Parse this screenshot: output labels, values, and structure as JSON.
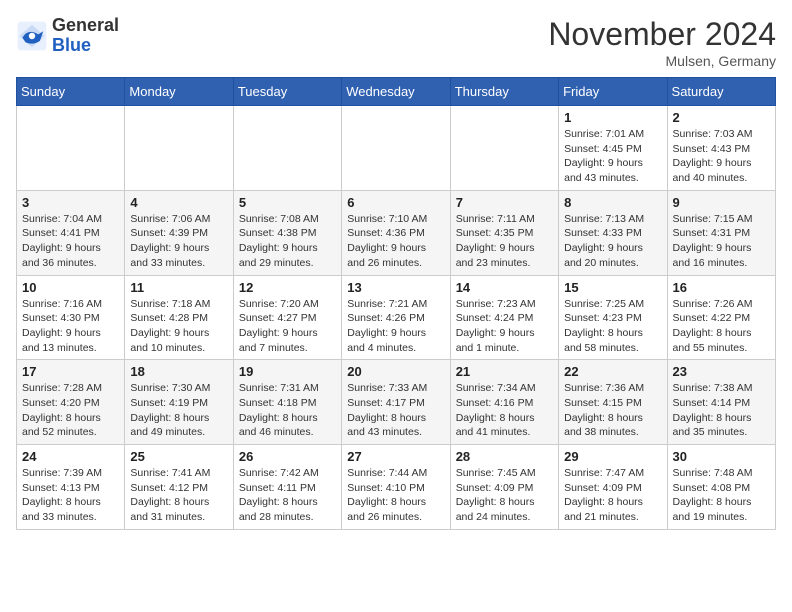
{
  "header": {
    "logo_general": "General",
    "logo_blue": "Blue",
    "month_title": "November 2024",
    "location": "Mulsen, Germany"
  },
  "columns": [
    "Sunday",
    "Monday",
    "Tuesday",
    "Wednesday",
    "Thursday",
    "Friday",
    "Saturday"
  ],
  "weeks": [
    [
      {
        "day": "",
        "info": ""
      },
      {
        "day": "",
        "info": ""
      },
      {
        "day": "",
        "info": ""
      },
      {
        "day": "",
        "info": ""
      },
      {
        "day": "",
        "info": ""
      },
      {
        "day": "1",
        "info": "Sunrise: 7:01 AM\nSunset: 4:45 PM\nDaylight: 9 hours\nand 43 minutes."
      },
      {
        "day": "2",
        "info": "Sunrise: 7:03 AM\nSunset: 4:43 PM\nDaylight: 9 hours\nand 40 minutes."
      }
    ],
    [
      {
        "day": "3",
        "info": "Sunrise: 7:04 AM\nSunset: 4:41 PM\nDaylight: 9 hours\nand 36 minutes."
      },
      {
        "day": "4",
        "info": "Sunrise: 7:06 AM\nSunset: 4:39 PM\nDaylight: 9 hours\nand 33 minutes."
      },
      {
        "day": "5",
        "info": "Sunrise: 7:08 AM\nSunset: 4:38 PM\nDaylight: 9 hours\nand 29 minutes."
      },
      {
        "day": "6",
        "info": "Sunrise: 7:10 AM\nSunset: 4:36 PM\nDaylight: 9 hours\nand 26 minutes."
      },
      {
        "day": "7",
        "info": "Sunrise: 7:11 AM\nSunset: 4:35 PM\nDaylight: 9 hours\nand 23 minutes."
      },
      {
        "day": "8",
        "info": "Sunrise: 7:13 AM\nSunset: 4:33 PM\nDaylight: 9 hours\nand 20 minutes."
      },
      {
        "day": "9",
        "info": "Sunrise: 7:15 AM\nSunset: 4:31 PM\nDaylight: 9 hours\nand 16 minutes."
      }
    ],
    [
      {
        "day": "10",
        "info": "Sunrise: 7:16 AM\nSunset: 4:30 PM\nDaylight: 9 hours\nand 13 minutes."
      },
      {
        "day": "11",
        "info": "Sunrise: 7:18 AM\nSunset: 4:28 PM\nDaylight: 9 hours\nand 10 minutes."
      },
      {
        "day": "12",
        "info": "Sunrise: 7:20 AM\nSunset: 4:27 PM\nDaylight: 9 hours\nand 7 minutes."
      },
      {
        "day": "13",
        "info": "Sunrise: 7:21 AM\nSunset: 4:26 PM\nDaylight: 9 hours\nand 4 minutes."
      },
      {
        "day": "14",
        "info": "Sunrise: 7:23 AM\nSunset: 4:24 PM\nDaylight: 9 hours\nand 1 minute."
      },
      {
        "day": "15",
        "info": "Sunrise: 7:25 AM\nSunset: 4:23 PM\nDaylight: 8 hours\nand 58 minutes."
      },
      {
        "day": "16",
        "info": "Sunrise: 7:26 AM\nSunset: 4:22 PM\nDaylight: 8 hours\nand 55 minutes."
      }
    ],
    [
      {
        "day": "17",
        "info": "Sunrise: 7:28 AM\nSunset: 4:20 PM\nDaylight: 8 hours\nand 52 minutes."
      },
      {
        "day": "18",
        "info": "Sunrise: 7:30 AM\nSunset: 4:19 PM\nDaylight: 8 hours\nand 49 minutes."
      },
      {
        "day": "19",
        "info": "Sunrise: 7:31 AM\nSunset: 4:18 PM\nDaylight: 8 hours\nand 46 minutes."
      },
      {
        "day": "20",
        "info": "Sunrise: 7:33 AM\nSunset: 4:17 PM\nDaylight: 8 hours\nand 43 minutes."
      },
      {
        "day": "21",
        "info": "Sunrise: 7:34 AM\nSunset: 4:16 PM\nDaylight: 8 hours\nand 41 minutes."
      },
      {
        "day": "22",
        "info": "Sunrise: 7:36 AM\nSunset: 4:15 PM\nDaylight: 8 hours\nand 38 minutes."
      },
      {
        "day": "23",
        "info": "Sunrise: 7:38 AM\nSunset: 4:14 PM\nDaylight: 8 hours\nand 35 minutes."
      }
    ],
    [
      {
        "day": "24",
        "info": "Sunrise: 7:39 AM\nSunset: 4:13 PM\nDaylight: 8 hours\nand 33 minutes."
      },
      {
        "day": "25",
        "info": "Sunrise: 7:41 AM\nSunset: 4:12 PM\nDaylight: 8 hours\nand 31 minutes."
      },
      {
        "day": "26",
        "info": "Sunrise: 7:42 AM\nSunset: 4:11 PM\nDaylight: 8 hours\nand 28 minutes."
      },
      {
        "day": "27",
        "info": "Sunrise: 7:44 AM\nSunset: 4:10 PM\nDaylight: 8 hours\nand 26 minutes."
      },
      {
        "day": "28",
        "info": "Sunrise: 7:45 AM\nSunset: 4:09 PM\nDaylight: 8 hours\nand 24 minutes."
      },
      {
        "day": "29",
        "info": "Sunrise: 7:47 AM\nSunset: 4:09 PM\nDaylight: 8 hours\nand 21 minutes."
      },
      {
        "day": "30",
        "info": "Sunrise: 7:48 AM\nSunset: 4:08 PM\nDaylight: 8 hours\nand 19 minutes."
      }
    ]
  ]
}
